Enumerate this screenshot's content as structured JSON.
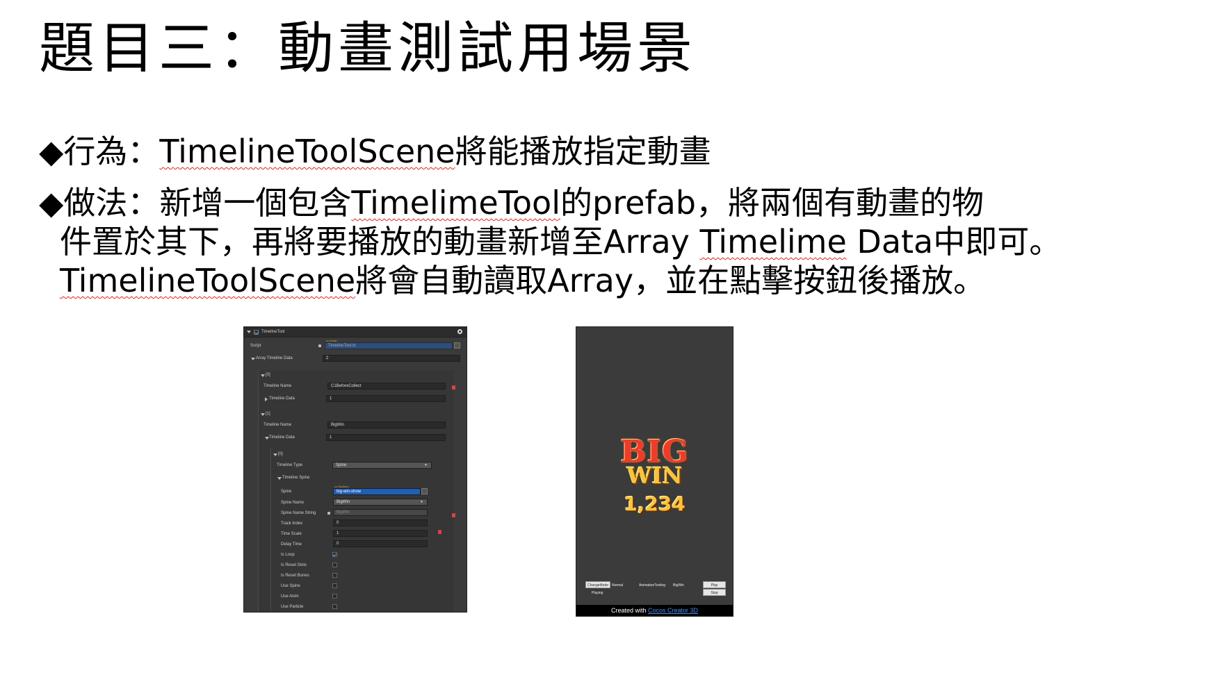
{
  "slide": {
    "title": "題目三：動畫測試用場景",
    "bullet1": {
      "marker": "◆",
      "label": "行為：",
      "em1": "TimelineToolScene",
      "text1": "將能播放指定動畫"
    },
    "bullet2": {
      "marker": "◆",
      "label": "做法：",
      "text1": "新增一個包含",
      "em1": "TimelimeTool",
      "text2": "的prefab，將兩個有動畫的物",
      "line2_text1": "件置於其下，再將要播放的動畫新增至Array ",
      "line2_em": "Timelime",
      "line2_text2": " Data中即可。",
      "line3_em": "TimelineToolScene",
      "line3_text": "將會自動讀取Array，並在點擊按鈕後播放。"
    }
  },
  "inspector": {
    "component": "TimelineTool",
    "script_label": "Script",
    "script_tag": "cc.Script",
    "script_value": "TimelineTool.ts",
    "array_label": "Array Timeline Data",
    "array_count": "2",
    "item0": {
      "index": "[0]",
      "name_label": "Timeline Name",
      "name_value": "C1BeforeCollect",
      "data_label": "Timeline Data",
      "data_value": "1"
    },
    "item1": {
      "index": "[1]",
      "name_label": "Timeline Name",
      "name_value": "BigWin",
      "data_label": "Timeline Data",
      "data_value": "1"
    },
    "sub0": {
      "index": "[0]",
      "type_label": "Timeline Type",
      "type_value": "Spine",
      "spine_section": "Timeline Spine",
      "spine_label": "Spine",
      "spine_tag": "cc.Skeleton",
      "spine_value": "big-win-show",
      "spine_name_label": "Spine Name",
      "spine_name_value": "BigWin",
      "spine_name_string_label": "Spine Name String",
      "spine_name_string_value": "BigWin",
      "track_label": "Track Index",
      "track_value": "0",
      "scale_label": "Time Scale",
      "scale_value": "1",
      "delay_label": "Delay Time",
      "delay_value": "0",
      "checks": [
        {
          "label": "Is Loop",
          "checked": true
        },
        {
          "label": "Is Reset Slots",
          "checked": false
        },
        {
          "label": "Is Reset Bones",
          "checked": false
        },
        {
          "label": "Use Spine",
          "checked": false
        },
        {
          "label": "Use Anim",
          "checked": false
        },
        {
          "label": "Use Particle",
          "checked": false
        }
      ]
    }
  },
  "game": {
    "big": "BIG",
    "win": "WIN",
    "amount": "1,234",
    "change_mode": "ChangeMode",
    "mode_value": "Normal",
    "playing": "Playing",
    "animation_testing": "AnimationTesting",
    "timeline_value": "BigWin",
    "play": "Play",
    "stop": "Stop",
    "footer_prefix": "Created with ",
    "footer_link": "Cocos Creator 3D"
  }
}
